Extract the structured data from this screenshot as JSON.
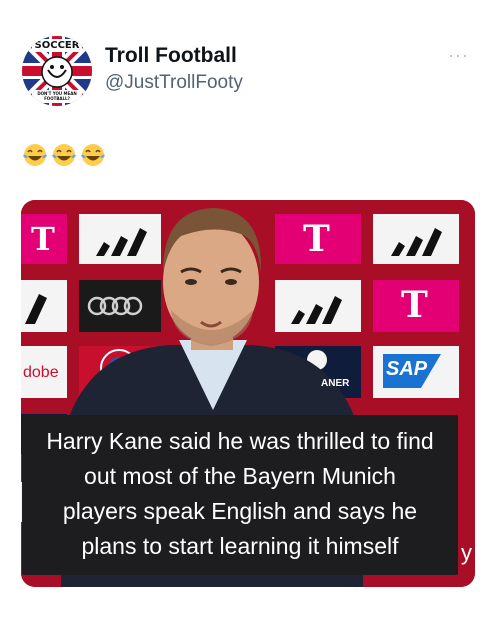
{
  "account": {
    "display_name": "Troll Football",
    "handle": "@JustTrollFooty",
    "avatar_top_text": "SOCCER",
    "avatar_bottom_text": "DON'T YOU MEAN FOOTBALL?"
  },
  "header": {
    "more_label": "···"
  },
  "post": {
    "emojis": [
      "tears-of-joy-emoji",
      "tears-of-joy-emoji",
      "tears-of-joy-emoji"
    ],
    "caption_lines": [
      "Harry Kane said he was thrilled to find",
      "out most of the Bayern Munich",
      "players speak English and says he",
      "plans to start learning it himself"
    ]
  },
  "sponsor_wall": {
    "logos": [
      "T",
      "T",
      "SAP",
      "dobe",
      "ANER",
      "AN",
      "S",
      "y"
    ]
  },
  "colors": {
    "wall_red": "#b0112a",
    "telekom_magenta": "#e20074",
    "sap_blue": "#1a73d1",
    "caption_bg": "#1d1d1f"
  }
}
